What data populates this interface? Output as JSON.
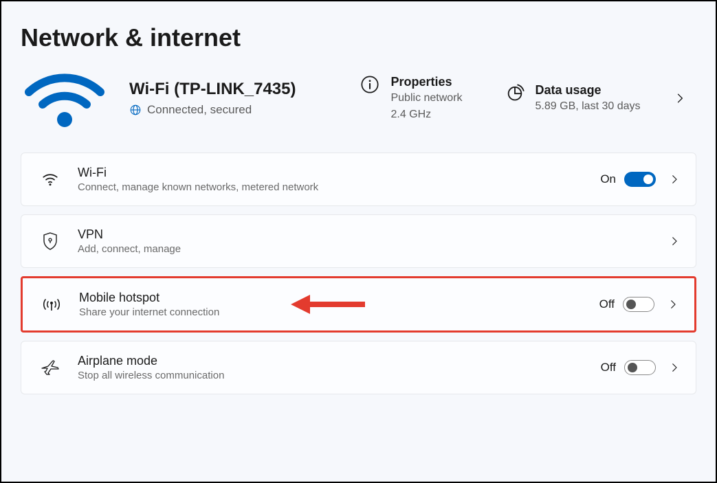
{
  "page": {
    "title": "Network & internet"
  },
  "hero": {
    "network_name": "Wi-Fi (TP-LINK_7435)",
    "status": "Connected, secured",
    "properties": {
      "label": "Properties",
      "line1": "Public network",
      "line2": "2.4 GHz"
    },
    "data_usage": {
      "label": "Data usage",
      "detail": "5.89 GB, last 30 days"
    }
  },
  "options": {
    "wifi": {
      "title": "Wi-Fi",
      "sub": "Connect, manage known networks, metered network",
      "state": "On",
      "on": true
    },
    "vpn": {
      "title": "VPN",
      "sub": "Add, connect, manage"
    },
    "hotspot": {
      "title": "Mobile hotspot",
      "sub": "Share your internet connection",
      "state": "Off",
      "on": false
    },
    "airplane": {
      "title": "Airplane mode",
      "sub": "Stop all wireless communication",
      "state": "Off",
      "on": false
    }
  }
}
